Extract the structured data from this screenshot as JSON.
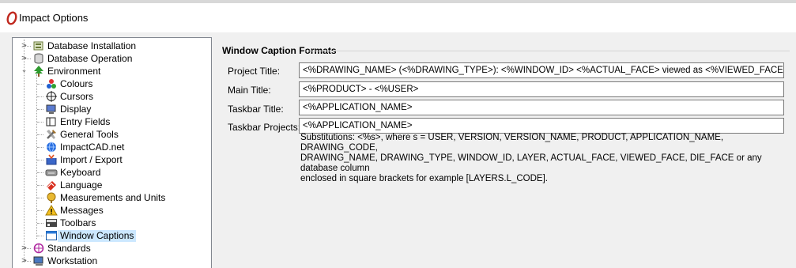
{
  "window": {
    "title": "Impact Options"
  },
  "tree": {
    "items": [
      {
        "label": "Database Installation",
        "expander": "collapsed",
        "icon": "database-install-icon"
      },
      {
        "label": "Database Operation",
        "expander": "collapsed",
        "icon": "database-icon"
      },
      {
        "label": "Environment",
        "expander": "expanded",
        "icon": "tree-icon"
      },
      {
        "label": "Colours",
        "icon": "colours-icon"
      },
      {
        "label": "Cursors",
        "icon": "cursors-icon"
      },
      {
        "label": "Display",
        "icon": "display-icon"
      },
      {
        "label": "Entry Fields",
        "icon": "entry-fields-icon"
      },
      {
        "label": "General Tools",
        "icon": "general-tools-icon"
      },
      {
        "label": "ImpactCAD.net",
        "icon": "globe-icon"
      },
      {
        "label": "Import / Export",
        "icon": "import-export-icon"
      },
      {
        "label": "Keyboard",
        "icon": "keyboard-icon"
      },
      {
        "label": "Language",
        "icon": "language-icon"
      },
      {
        "label": "Measurements and Units",
        "icon": "measurements-icon"
      },
      {
        "label": "Messages",
        "icon": "warning-icon"
      },
      {
        "label": "Toolbars",
        "icon": "toolbars-icon"
      },
      {
        "label": "Window Captions",
        "icon": "window-icon",
        "selected": true
      },
      {
        "label": "Standards",
        "expander": "collapsed",
        "icon": "standards-icon"
      },
      {
        "label": "Workstation",
        "expander": "collapsed",
        "icon": "workstation-icon"
      }
    ]
  },
  "panel": {
    "section_title": "Window Caption Formats",
    "fields": [
      {
        "label": "Project Title:",
        "value": "<%DRAWING_NAME> (<%DRAWING_TYPE>): <%WINDOW_ID> <%ACTUAL_FACE> viewed as  <%VIEWED_FACE>"
      },
      {
        "label": "Main Title:",
        "value": "<%PRODUCT> - <%USER>"
      },
      {
        "label": "Taskbar Title:",
        "value": "<%APPLICATION_NAME>"
      },
      {
        "label": "Taskbar Projects:",
        "value": "<%APPLICATION_NAME>"
      }
    ],
    "substitutions": [
      "Substitutions: <%s>, where s = USER, VERSION, VERSION_NAME, PRODUCT, APPLICATION_NAME, DRAWING_CODE,",
      "DRAWING_NAME, DRAWING_TYPE, WINDOW_ID, LAYER, ACTUAL_FACE, VIEWED_FACE, DIE_FACE or any database column",
      "enclosed in square brackets for example [LAYERS.L_CODE]."
    ]
  },
  "colors": {
    "selection": "#cce8ff",
    "tree_border": "#828790",
    "field_border": "#7a7a7a",
    "logo_red": "#c0281e"
  }
}
